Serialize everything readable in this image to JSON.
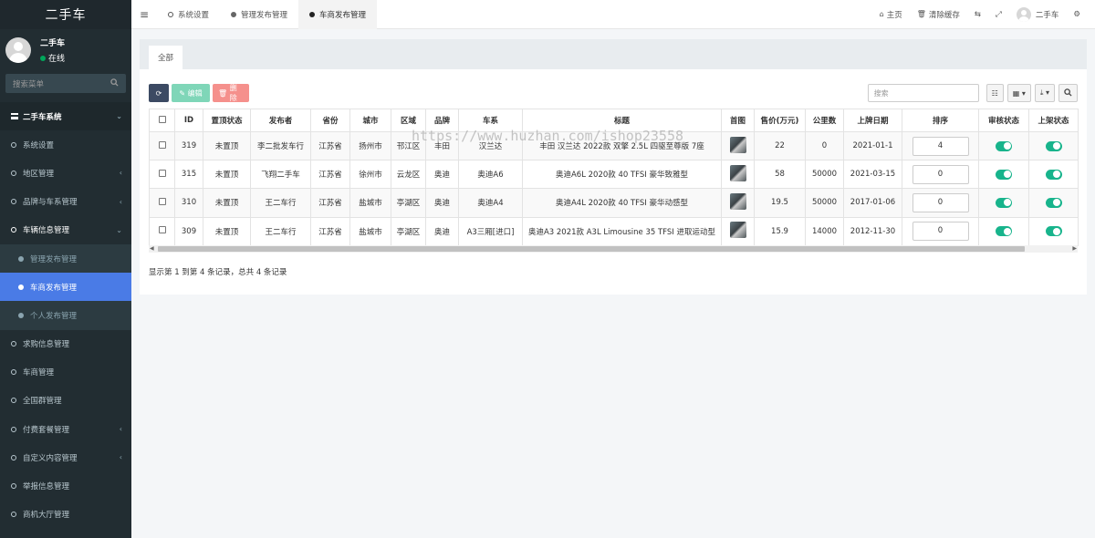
{
  "sidebar": {
    "brand": "二手车",
    "user_name": "二手车",
    "user_status": "在线",
    "search_placeholder": "搜索菜单",
    "items": [
      {
        "label": "二手车系统",
        "type": "header"
      },
      {
        "label": "系统设置"
      },
      {
        "label": "地区管理",
        "caret": "‹"
      },
      {
        "label": "品牌与车系管理",
        "caret": "‹"
      },
      {
        "label": "车辆信息管理",
        "type": "open"
      },
      {
        "label": "管理发布管理",
        "type": "sub"
      },
      {
        "label": "车商发布管理",
        "type": "sub-active"
      },
      {
        "label": "个人发布管理",
        "type": "sub"
      },
      {
        "label": "求购信息管理"
      },
      {
        "label": "车商管理"
      },
      {
        "label": "全国群管理"
      },
      {
        "label": "付费套餐管理",
        "caret": "‹"
      },
      {
        "label": "自定义内容管理",
        "caret": "‹"
      },
      {
        "label": "举报信息管理"
      },
      {
        "label": "商机大厅管理"
      }
    ]
  },
  "topbar": {
    "tabs": [
      {
        "label": "系统设置"
      },
      {
        "label": "管理发布管理"
      },
      {
        "label": "车商发布管理"
      }
    ],
    "home": "主页",
    "clear_cache": "清除缓存",
    "user": "二手车"
  },
  "panel": {
    "tab_all": "全部",
    "edit_label": "编辑",
    "delete_label": "删除",
    "search_placeholder": "搜索"
  },
  "table": {
    "headers": [
      "ID",
      "置顶状态",
      "发布者",
      "省份",
      "城市",
      "区域",
      "品牌",
      "车系",
      "标题",
      "首图",
      "售价(万元)",
      "公里数",
      "上牌日期",
      "排序",
      "审核状态",
      "上架状态"
    ],
    "rows": [
      {
        "id": "319",
        "top": "未置顶",
        "publisher": "李二批发车行",
        "province": "江苏省",
        "city": "扬州市",
        "district": "邗江区",
        "brand": "丰田",
        "series": "汉兰达",
        "title": "丰田 汉兰达 2022款 双擎 2.5L 四驱至尊版 7座",
        "price": "22",
        "km": "0",
        "date": "2021-01-1",
        "sort": "4"
      },
      {
        "id": "315",
        "top": "未置顶",
        "publisher": "飞翔二手车",
        "province": "江苏省",
        "city": "徐州市",
        "district": "云龙区",
        "brand": "奥迪",
        "series": "奥迪A6",
        "title": "奥迪A6L 2020款 40 TFSI 豪华致雅型",
        "price": "58",
        "km": "50000",
        "date": "2021-03-15",
        "sort": "0"
      },
      {
        "id": "310",
        "top": "未置顶",
        "publisher": "王二车行",
        "province": "江苏省",
        "city": "盐城市",
        "district": "亭湖区",
        "brand": "奥迪",
        "series": "奥迪A4",
        "title": "奥迪A4L 2020款 40 TFSI 豪华动感型",
        "price": "19.5",
        "km": "50000",
        "date": "2017-01-06",
        "sort": "0"
      },
      {
        "id": "309",
        "top": "未置顶",
        "publisher": "王二车行",
        "province": "江苏省",
        "city": "盐城市",
        "district": "亭湖区",
        "brand": "奥迪",
        "series": "A3三厢[进口]",
        "title": "奥迪A3 2021款 A3L Limousine 35 TFSI 进取运动型",
        "price": "15.9",
        "km": "14000",
        "date": "2012-11-30",
        "sort": "0"
      }
    ]
  },
  "pager_info": "显示第 1 到第 4 条记录，总共 4 条记录",
  "watermark": "https://www.huzhan.com/ishop23558"
}
